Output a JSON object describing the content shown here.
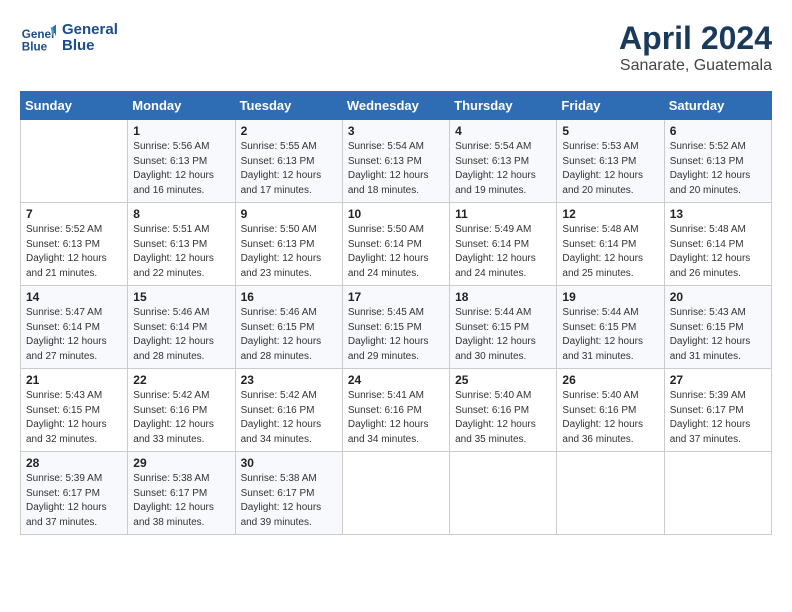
{
  "header": {
    "logo_line1": "General",
    "logo_line2": "Blue",
    "month": "April 2024",
    "location": "Sanarate, Guatemala"
  },
  "columns": [
    "Sunday",
    "Monday",
    "Tuesday",
    "Wednesday",
    "Thursday",
    "Friday",
    "Saturday"
  ],
  "weeks": [
    [
      {
        "day": "",
        "info": ""
      },
      {
        "day": "1",
        "info": "Sunrise: 5:56 AM\nSunset: 6:13 PM\nDaylight: 12 hours\nand 16 minutes."
      },
      {
        "day": "2",
        "info": "Sunrise: 5:55 AM\nSunset: 6:13 PM\nDaylight: 12 hours\nand 17 minutes."
      },
      {
        "day": "3",
        "info": "Sunrise: 5:54 AM\nSunset: 6:13 PM\nDaylight: 12 hours\nand 18 minutes."
      },
      {
        "day": "4",
        "info": "Sunrise: 5:54 AM\nSunset: 6:13 PM\nDaylight: 12 hours\nand 19 minutes."
      },
      {
        "day": "5",
        "info": "Sunrise: 5:53 AM\nSunset: 6:13 PM\nDaylight: 12 hours\nand 20 minutes."
      },
      {
        "day": "6",
        "info": "Sunrise: 5:52 AM\nSunset: 6:13 PM\nDaylight: 12 hours\nand 20 minutes."
      }
    ],
    [
      {
        "day": "7",
        "info": "Sunrise: 5:52 AM\nSunset: 6:13 PM\nDaylight: 12 hours\nand 21 minutes."
      },
      {
        "day": "8",
        "info": "Sunrise: 5:51 AM\nSunset: 6:13 PM\nDaylight: 12 hours\nand 22 minutes."
      },
      {
        "day": "9",
        "info": "Sunrise: 5:50 AM\nSunset: 6:13 PM\nDaylight: 12 hours\nand 23 minutes."
      },
      {
        "day": "10",
        "info": "Sunrise: 5:50 AM\nSunset: 6:14 PM\nDaylight: 12 hours\nand 24 minutes."
      },
      {
        "day": "11",
        "info": "Sunrise: 5:49 AM\nSunset: 6:14 PM\nDaylight: 12 hours\nand 24 minutes."
      },
      {
        "day": "12",
        "info": "Sunrise: 5:48 AM\nSunset: 6:14 PM\nDaylight: 12 hours\nand 25 minutes."
      },
      {
        "day": "13",
        "info": "Sunrise: 5:48 AM\nSunset: 6:14 PM\nDaylight: 12 hours\nand 26 minutes."
      }
    ],
    [
      {
        "day": "14",
        "info": "Sunrise: 5:47 AM\nSunset: 6:14 PM\nDaylight: 12 hours\nand 27 minutes."
      },
      {
        "day": "15",
        "info": "Sunrise: 5:46 AM\nSunset: 6:14 PM\nDaylight: 12 hours\nand 28 minutes."
      },
      {
        "day": "16",
        "info": "Sunrise: 5:46 AM\nSunset: 6:15 PM\nDaylight: 12 hours\nand 28 minutes."
      },
      {
        "day": "17",
        "info": "Sunrise: 5:45 AM\nSunset: 6:15 PM\nDaylight: 12 hours\nand 29 minutes."
      },
      {
        "day": "18",
        "info": "Sunrise: 5:44 AM\nSunset: 6:15 PM\nDaylight: 12 hours\nand 30 minutes."
      },
      {
        "day": "19",
        "info": "Sunrise: 5:44 AM\nSunset: 6:15 PM\nDaylight: 12 hours\nand 31 minutes."
      },
      {
        "day": "20",
        "info": "Sunrise: 5:43 AM\nSunset: 6:15 PM\nDaylight: 12 hours\nand 31 minutes."
      }
    ],
    [
      {
        "day": "21",
        "info": "Sunrise: 5:43 AM\nSunset: 6:15 PM\nDaylight: 12 hours\nand 32 minutes."
      },
      {
        "day": "22",
        "info": "Sunrise: 5:42 AM\nSunset: 6:16 PM\nDaylight: 12 hours\nand 33 minutes."
      },
      {
        "day": "23",
        "info": "Sunrise: 5:42 AM\nSunset: 6:16 PM\nDaylight: 12 hours\nand 34 minutes."
      },
      {
        "day": "24",
        "info": "Sunrise: 5:41 AM\nSunset: 6:16 PM\nDaylight: 12 hours\nand 34 minutes."
      },
      {
        "day": "25",
        "info": "Sunrise: 5:40 AM\nSunset: 6:16 PM\nDaylight: 12 hours\nand 35 minutes."
      },
      {
        "day": "26",
        "info": "Sunrise: 5:40 AM\nSunset: 6:16 PM\nDaylight: 12 hours\nand 36 minutes."
      },
      {
        "day": "27",
        "info": "Sunrise: 5:39 AM\nSunset: 6:17 PM\nDaylight: 12 hours\nand 37 minutes."
      }
    ],
    [
      {
        "day": "28",
        "info": "Sunrise: 5:39 AM\nSunset: 6:17 PM\nDaylight: 12 hours\nand 37 minutes."
      },
      {
        "day": "29",
        "info": "Sunrise: 5:38 AM\nSunset: 6:17 PM\nDaylight: 12 hours\nand 38 minutes."
      },
      {
        "day": "30",
        "info": "Sunrise: 5:38 AM\nSunset: 6:17 PM\nDaylight: 12 hours\nand 39 minutes."
      },
      {
        "day": "",
        "info": ""
      },
      {
        "day": "",
        "info": ""
      },
      {
        "day": "",
        "info": ""
      },
      {
        "day": "",
        "info": ""
      }
    ]
  ]
}
